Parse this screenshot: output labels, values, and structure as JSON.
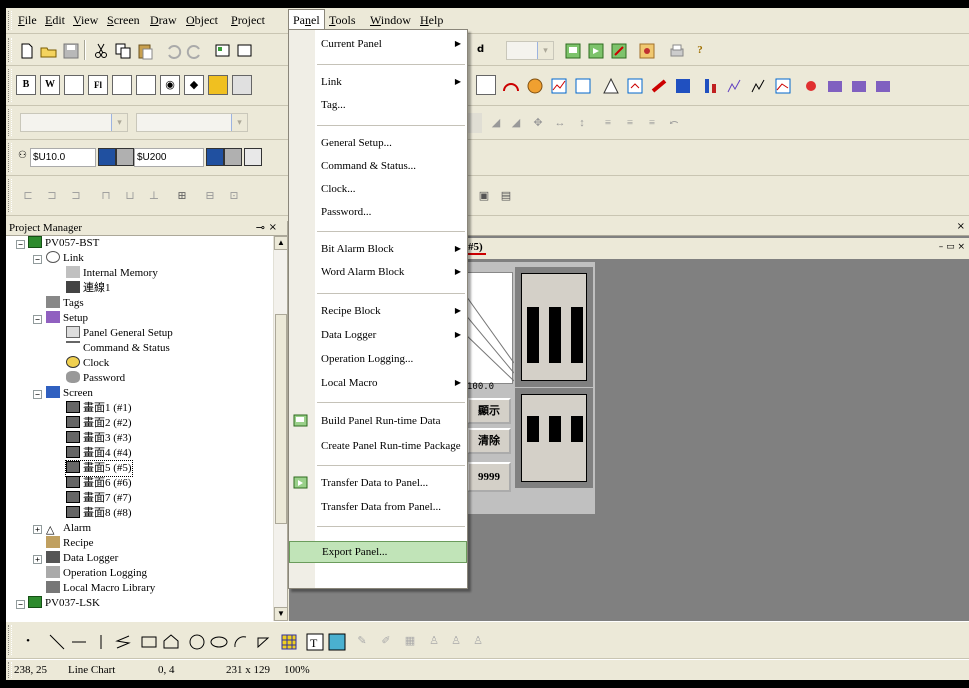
{
  "menubar": {
    "items": [
      {
        "label": "File",
        "hotkey": "F"
      },
      {
        "label": "Edit",
        "hotkey": "E"
      },
      {
        "label": "View",
        "hotkey": "V"
      },
      {
        "label": "Screen",
        "hotkey": "S"
      },
      {
        "label": "Draw",
        "hotkey": "D"
      },
      {
        "label": "Object",
        "hotkey": "O"
      },
      {
        "label": "Project",
        "hotkey": "P"
      },
      {
        "label": "Panel",
        "hotkey": "n"
      },
      {
        "label": "Tools",
        "hotkey": "T"
      },
      {
        "label": "Window",
        "hotkey": "W"
      },
      {
        "label": "Help",
        "hotkey": "H"
      }
    ]
  },
  "toolbar": {
    "var_field_1": "$U10.0",
    "var_field_2": "$U200"
  },
  "project_manager": {
    "title": "Project Manager",
    "pin": "⌂",
    "close": "×",
    "nodes": [
      {
        "label": "PV057-BST",
        "icon": "panel-icon"
      },
      {
        "label": "Link",
        "icon": "link-icon"
      },
      {
        "label": "Internal Memory",
        "icon": "memory-icon"
      },
      {
        "label": "連線1",
        "icon": "connection-icon"
      },
      {
        "label": "Tags",
        "icon": "tags-icon"
      },
      {
        "label": "Setup",
        "icon": "setup-icon"
      },
      {
        "label": "Panel General Setup",
        "icon": "panel-setup-icon"
      },
      {
        "label": "Command & Status",
        "icon": "command-icon"
      },
      {
        "label": "Clock",
        "icon": "clock-icon"
      },
      {
        "label": "Password",
        "icon": "password-icon"
      },
      {
        "label": "Screen",
        "icon": "screen-folder-icon"
      },
      {
        "label": "畫面1 (#1)",
        "icon": "screen-icon"
      },
      {
        "label": "畫面2 (#2)",
        "icon": "screen-icon"
      },
      {
        "label": "畫面3 (#3)",
        "icon": "screen-icon"
      },
      {
        "label": "畫面4 (#4)",
        "icon": "screen-icon"
      },
      {
        "label": "畫面5 (#5)",
        "icon": "screen-icon"
      },
      {
        "label": "畫面6 (#6)",
        "icon": "screen-icon"
      },
      {
        "label": "畫面7 (#7)",
        "icon": "screen-icon"
      },
      {
        "label": "畫面8 (#8)",
        "icon": "screen-icon"
      },
      {
        "label": "Alarm",
        "icon": "alarm-icon"
      },
      {
        "label": "Recipe",
        "icon": "recipe-icon"
      },
      {
        "label": "Data Logger",
        "icon": "data-logger-icon"
      },
      {
        "label": "Operation Logging",
        "icon": "operation-logging-icon"
      },
      {
        "label": "Local Macro Library",
        "icon": "macro-library-icon"
      },
      {
        "label": "PV037-LSK",
        "icon": "panel-icon"
      }
    ]
  },
  "document": {
    "tab_label": "#5)",
    "close": "×",
    "chart_value": "100.0",
    "btn_display": "顯示",
    "btn_clear": "清除",
    "btn_value": "9999"
  },
  "panel_menu": {
    "items": [
      {
        "label": "Current Panel",
        "submenu": true
      },
      {
        "label": "Link",
        "submenu": true
      },
      {
        "label": "Tag...",
        "submenu": false
      },
      {
        "label": "General Setup...",
        "submenu": false
      },
      {
        "label": "Command & Status...",
        "submenu": false
      },
      {
        "label": "Clock...",
        "submenu": false
      },
      {
        "label": "Password...",
        "submenu": false
      },
      {
        "label": "Bit Alarm Block",
        "submenu": true
      },
      {
        "label": "Word Alarm Block",
        "submenu": true
      },
      {
        "label": "Recipe Block",
        "submenu": true
      },
      {
        "label": "Data Logger",
        "submenu": true
      },
      {
        "label": "Operation Logging...",
        "submenu": false
      },
      {
        "label": "Local Macro",
        "submenu": true
      },
      {
        "label": "Build Panel Run-time Data",
        "submenu": false
      },
      {
        "label": "Create Panel Run-time Package",
        "submenu": false
      },
      {
        "label": "Transfer Data to Panel...",
        "submenu": false
      },
      {
        "label": "Transfer Data from Panel...",
        "submenu": false
      },
      {
        "label": "Export Panel...",
        "submenu": false
      }
    ],
    "arrow": "▶"
  },
  "statusbar": {
    "coords": "238, 25",
    "object": "Line Chart",
    "position": "0, 4",
    "size": "231 x 129",
    "zoom": "100%"
  },
  "colors": {
    "chrome": "#ece9d8",
    "workspace": "#808080",
    "menu_highlight": "#c1e4b8"
  }
}
